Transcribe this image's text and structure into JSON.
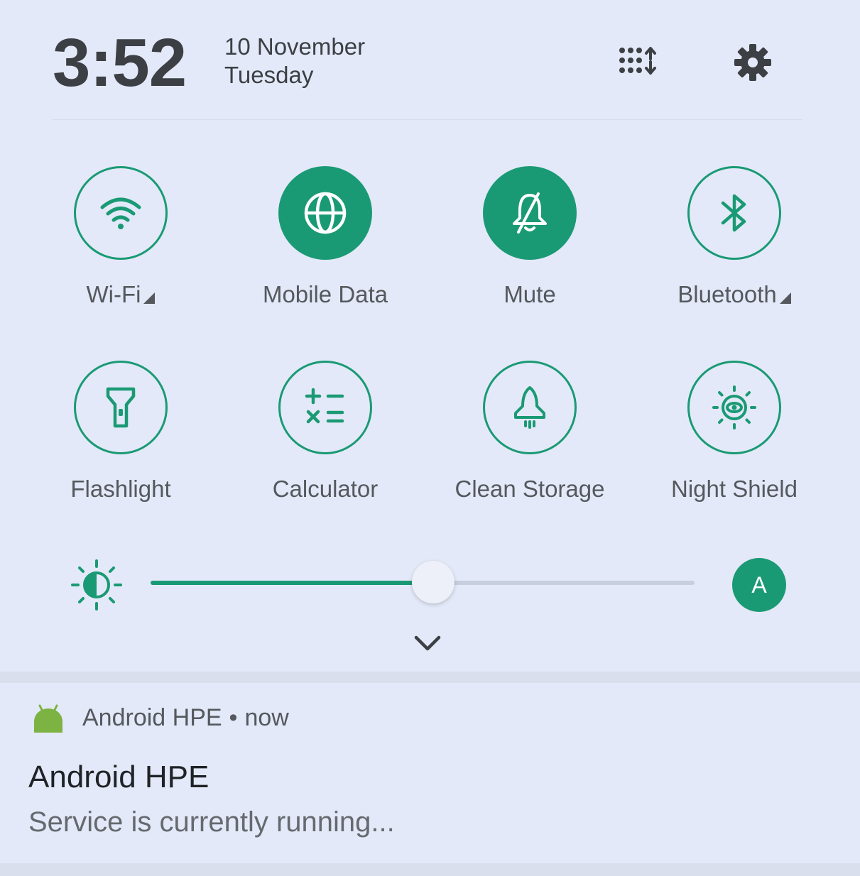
{
  "header": {
    "time": "3:52",
    "date": "10 November",
    "day": "Tuesday",
    "edit_icon": "edit-tiles-icon",
    "settings_icon": "gear-icon"
  },
  "tiles": [
    {
      "label": "Wi-Fi",
      "icon": "wifi-icon",
      "active": false,
      "expandable": true
    },
    {
      "label": "Mobile Data",
      "icon": "globe-icon",
      "active": true,
      "expandable": false
    },
    {
      "label": "Mute",
      "icon": "bell-off-icon",
      "active": true,
      "expandable": false
    },
    {
      "label": "Bluetooth",
      "icon": "bluetooth-icon",
      "active": false,
      "expandable": true
    },
    {
      "label": "Flashlight",
      "icon": "flashlight-icon",
      "active": false,
      "expandable": false
    },
    {
      "label": "Calculator",
      "icon": "calculator-icon",
      "active": false,
      "expandable": false
    },
    {
      "label": "Clean Storage",
      "icon": "rocket-icon",
      "active": false,
      "expandable": false
    },
    {
      "label": "Night Shield",
      "icon": "eye-sun-icon",
      "active": false,
      "expandable": false
    }
  ],
  "brightness": {
    "level_percent": 52,
    "auto_label": "A"
  },
  "notification": {
    "app_name": "Android HPE",
    "separator": "•",
    "time": "now",
    "title": "Android HPE",
    "text": "Service is currently running..."
  },
  "colors": {
    "accent": "#1a9a74",
    "background": "#e3e9f8",
    "text": "#55585d",
    "android_green": "#7cb342"
  }
}
